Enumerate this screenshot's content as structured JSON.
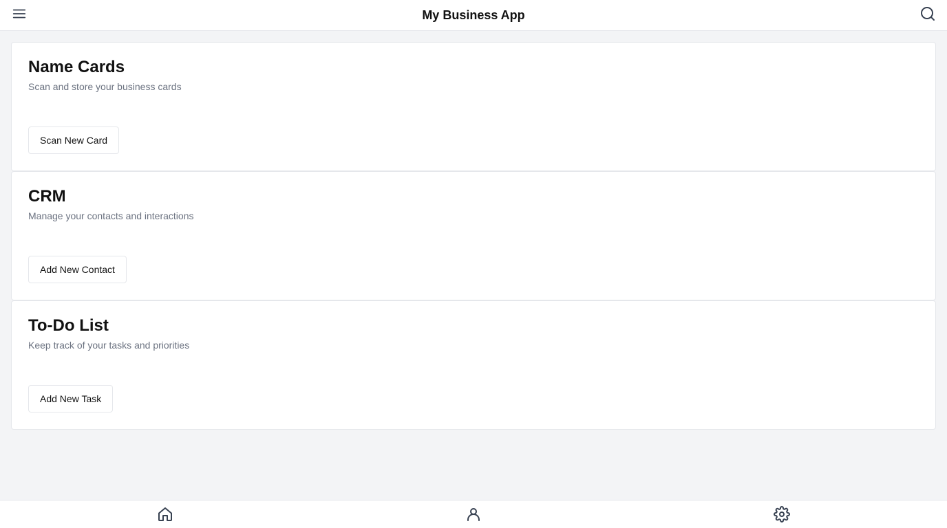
{
  "header": {
    "title": "My Business App",
    "menu_icon": "menu-icon",
    "search_icon": "search-icon"
  },
  "cards": [
    {
      "title": "Name Cards",
      "description": "Scan and store your business cards",
      "button_label": "Scan New Card"
    },
    {
      "title": "CRM",
      "description": "Manage your contacts and interactions",
      "button_label": "Add New Contact"
    },
    {
      "title": "To-Do List",
      "description": "Keep track of your tasks and priorities",
      "button_label": "Add New Task"
    }
  ],
  "bottom_nav": {
    "items": [
      {
        "icon": "home-icon"
      },
      {
        "icon": "user-icon"
      },
      {
        "icon": "gear-icon"
      }
    ]
  },
  "colors": {
    "background": "#f3f4f6",
    "surface": "#ffffff",
    "border": "#e5e7eb",
    "text_primary": "#111111",
    "text_secondary": "#6b7280"
  }
}
